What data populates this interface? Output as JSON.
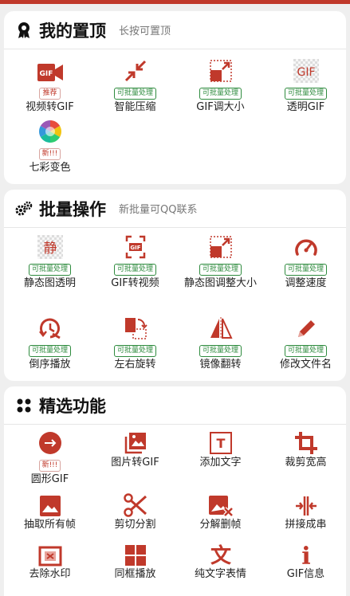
{
  "colors": {
    "accent": "#c0392b",
    "badge_green": "#2e8b3e"
  },
  "pinned": {
    "title": "我的置顶",
    "subtitle": "长按可置顶",
    "items": [
      {
        "label": "视频转GIF",
        "badge": "推荐",
        "icon": "video-gif-icon"
      },
      {
        "label": "智能压缩",
        "badge": "可批量处理",
        "icon": "compress-arrows-icon"
      },
      {
        "label": "GIF调大小",
        "badge": "可批量处理",
        "icon": "resize-icon"
      },
      {
        "label": "透明GIF",
        "badge": "可批量处理",
        "icon": "transparent-gif-icon"
      },
      {
        "label": "七彩变色",
        "badge": "新!!!",
        "icon": "color-wheel-icon"
      }
    ]
  },
  "batch": {
    "title": "批量操作",
    "subtitle": "新批量可QQ联系",
    "items": [
      {
        "label": "静态图透明",
        "badge": "可批量处理",
        "icon": "static-transparent-icon",
        "glyph": "静"
      },
      {
        "label": "GIF转视频",
        "badge": "可批量处理",
        "icon": "gif-to-video-icon"
      },
      {
        "label": "静态图调整大小",
        "badge": "可批量处理",
        "icon": "static-resize-icon"
      },
      {
        "label": "调整速度",
        "badge": "可批量处理",
        "icon": "speedometer-icon"
      },
      {
        "label": "倒序播放",
        "badge": "可批量处理",
        "icon": "reverse-play-icon"
      },
      {
        "label": "左右旋转",
        "badge": "可批量处理",
        "icon": "rotate-icon"
      },
      {
        "label": "镜像翻转",
        "badge": "可批量处理",
        "icon": "mirror-flip-icon"
      },
      {
        "label": "修改文件名",
        "badge": "可批量处理",
        "icon": "pencil-icon"
      }
    ]
  },
  "featured": {
    "title": "精选功能",
    "items": [
      {
        "label": "圆形GIF",
        "badge": "新!!!",
        "icon": "circle-gif-icon"
      },
      {
        "label": "图片转GIF",
        "icon": "images-to-gif-icon"
      },
      {
        "label": "添加文字",
        "icon": "add-text-icon",
        "glyph": "T"
      },
      {
        "label": "裁剪宽高",
        "icon": "crop-icon"
      },
      {
        "label": "抽取所有帧",
        "icon": "extract-frames-icon"
      },
      {
        "label": "剪切分割",
        "icon": "scissors-icon"
      },
      {
        "label": "分解删帧",
        "icon": "delete-frame-icon"
      },
      {
        "label": "拼接成串",
        "icon": "join-icon"
      },
      {
        "label": "去除水印",
        "icon": "remove-watermark-icon"
      },
      {
        "label": "同框播放",
        "icon": "grid-play-icon"
      },
      {
        "label": "纯文字表情",
        "icon": "text-emoji-icon",
        "glyph": "文"
      },
      {
        "label": "GIF信息",
        "icon": "info-icon",
        "glyph": "i"
      }
    ]
  }
}
